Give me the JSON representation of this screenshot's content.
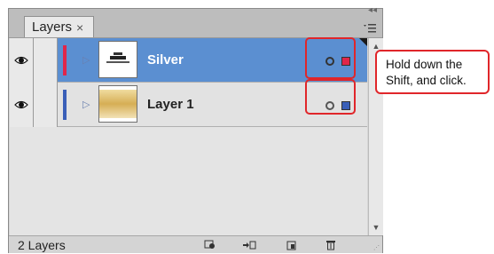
{
  "panel": {
    "tab_label": "Layers",
    "tab_close": "×",
    "collapse_glyph": "▴▴",
    "menu_glyph": "☰"
  },
  "layers": [
    {
      "name": "Silver",
      "selected": true,
      "color": "#e0264a",
      "select_square_color": "#e0264a"
    },
    {
      "name": "Layer 1",
      "selected": false,
      "color": "#3a5fb8",
      "select_square_color": "#3a5fb8"
    }
  ],
  "footer": {
    "count": "2 Layers"
  },
  "callout": {
    "line1": "Hold down the",
    "line2": "Shift, and click."
  },
  "colors": {
    "highlight": "#e0262a",
    "selected_row": "#5b8fd1"
  }
}
